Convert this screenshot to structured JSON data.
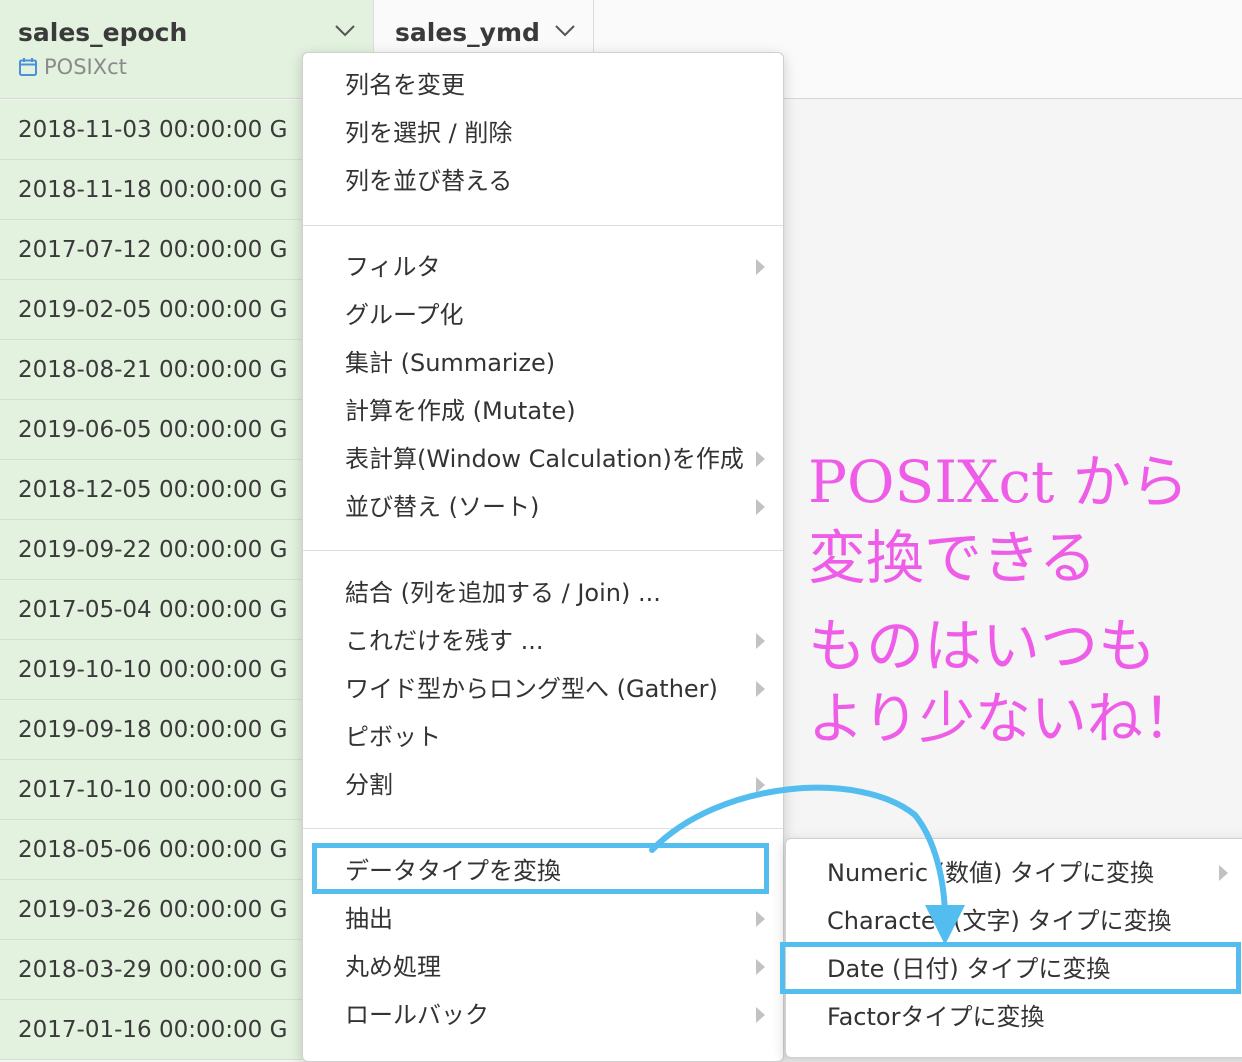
{
  "columns": [
    {
      "name": "sales_epoch",
      "type": "POSIXct"
    },
    {
      "name": "sales_ymd"
    }
  ],
  "rows": [
    "2018-11-03 00:00:00 G",
    "2018-11-18 00:00:00 G",
    "2017-07-12 00:00:00 G",
    "2019-02-05 00:00:00 G",
    "2018-08-21 00:00:00 G",
    "2019-06-05 00:00:00 G",
    "2018-12-05 00:00:00 G",
    "2019-09-22 00:00:00 G",
    "2017-05-04 00:00:00 G",
    "2019-10-10 00:00:00 G",
    "2019-09-18 00:00:00 G",
    "2017-10-10 00:00:00 G",
    "2018-05-06 00:00:00 G",
    "2019-03-26 00:00:00 G",
    "2018-03-29 00:00:00 G",
    "2017-01-16 00:00:00 G"
  ],
  "menu": {
    "group1": [
      "列名を変更",
      "列を選択 / 削除",
      "列を並び替える"
    ],
    "group2": [
      {
        "label": "フィルタ",
        "submenu": true
      },
      {
        "label": "グループ化",
        "submenu": false
      },
      {
        "label": "集計 (Summarize)",
        "submenu": false
      },
      {
        "label": "計算を作成 (Mutate)",
        "submenu": false
      },
      {
        "label": "表計算(Window Calculation)を作成",
        "submenu": true
      },
      {
        "label": "並び替え (ソート)",
        "submenu": true
      }
    ],
    "group3": [
      {
        "label": "結合 (列を追加する / Join) ...",
        "submenu": false
      },
      {
        "label": "これだけを残す ...",
        "submenu": true
      },
      {
        "label": "ワイド型からロング型へ (Gather)",
        "submenu": true
      },
      {
        "label": "ピボット",
        "submenu": false
      },
      {
        "label": "分割",
        "submenu": true
      }
    ],
    "group4": [
      {
        "label": "データタイプを変換",
        "submenu": false
      },
      {
        "label": "抽出",
        "submenu": true
      },
      {
        "label": "丸め処理",
        "submenu": true
      },
      {
        "label": "ロールバック",
        "submenu": true
      }
    ]
  },
  "submenu": [
    {
      "label": "Numeric (数値) タイプに変換",
      "submenu": true
    },
    {
      "label": "Character (文字) タイプに変換",
      "submenu": false
    },
    {
      "label": "Date (日付) タイプに変換",
      "submenu": false
    },
    {
      "label": "Factorタイプに変換",
      "submenu": false
    }
  ],
  "annotation": [
    "POSIXct から",
    "変換できる",
    "ものはいつも",
    "より少ないね！"
  ],
  "colors": {
    "active_column_bg": "#e3f1df",
    "highlight": "#53bdf0",
    "annotation": "#ee5ce8",
    "type_icon": "#4a90d9"
  },
  "icons": {
    "column_type": "calendar-icon",
    "column_menu": "chevron-down-icon",
    "submenu": "caret-right-icon"
  }
}
